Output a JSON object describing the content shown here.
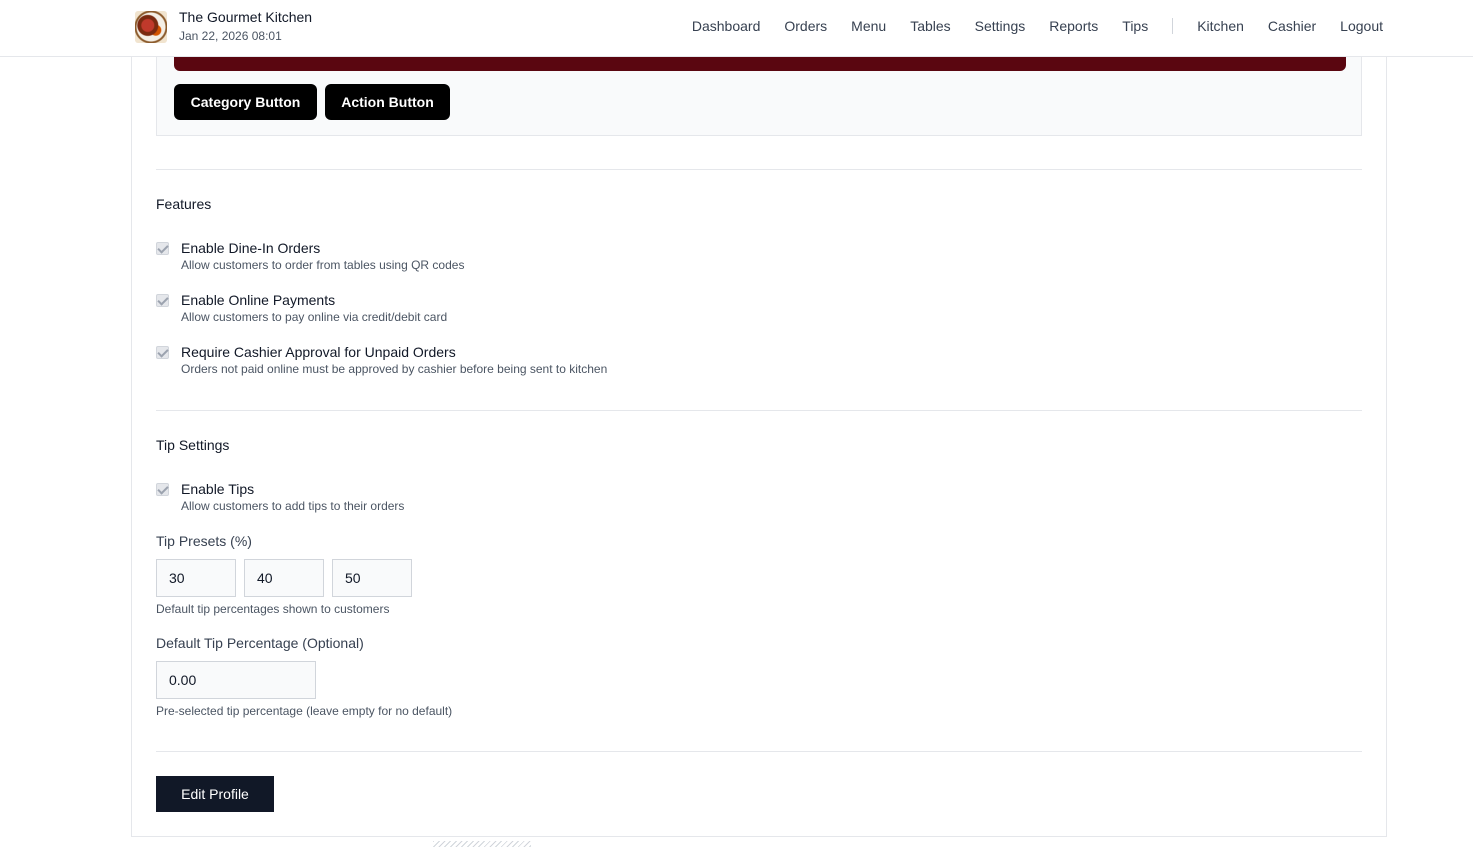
{
  "header": {
    "restaurant_name": "The Gourmet Kitchen",
    "datetime": "Jan 22, 2026 08:01",
    "nav": [
      "Dashboard",
      "Orders",
      "Menu",
      "Tables",
      "Settings",
      "Reports",
      "Tips"
    ],
    "nav_right": [
      "Kitchen",
      "Cashier",
      "Logout"
    ]
  },
  "preview": {
    "bar_color": "#5a0610",
    "category_button": "Category Button",
    "action_button": "Action Button"
  },
  "features": {
    "title": "Features",
    "items": [
      {
        "label": "Enable Dine-In Orders",
        "desc": "Allow customers to order from tables using QR codes",
        "checked": true
      },
      {
        "label": "Enable Online Payments",
        "desc": "Allow customers to pay online via credit/debit card",
        "checked": true
      },
      {
        "label": "Require Cashier Approval for Unpaid Orders",
        "desc": "Orders not paid online must be approved by cashier before being sent to kitchen",
        "checked": true
      }
    ]
  },
  "tips": {
    "title": "Tip Settings",
    "enable_label": "Enable Tips",
    "enable_desc": "Allow customers to add tips to their orders",
    "enable_checked": true,
    "presets_label": "Tip Presets (%)",
    "presets": [
      "30",
      "40",
      "50"
    ],
    "presets_help": "Default tip percentages shown to customers",
    "default_label": "Default Tip Percentage (Optional)",
    "default_value": "0.00",
    "default_help": "Pre-selected tip percentage (leave empty for no default)"
  },
  "actions": {
    "edit_profile": "Edit Profile"
  }
}
